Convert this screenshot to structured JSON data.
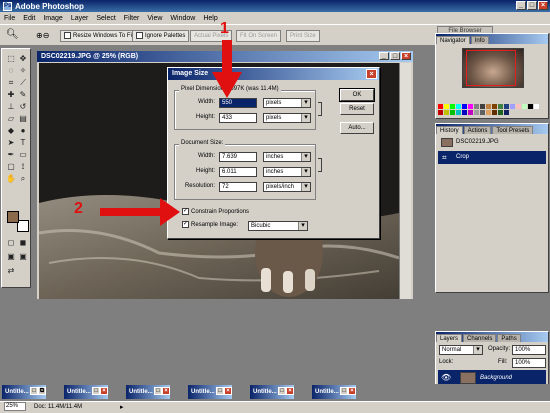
{
  "app": {
    "title": "Adobe Photoshop"
  },
  "menu": [
    "File",
    "Edit",
    "Image",
    "Layer",
    "Select",
    "Filter",
    "View",
    "Window",
    "Help"
  ],
  "options": {
    "resize_windows": "Resize Windows To Fit",
    "ignore_palettes": "Ignore Palettes",
    "actual_pixels": "Actual Pixels",
    "fit_on_screen": "Fit On Screen",
    "print_size": "Print Size",
    "file_browser": "File Browser"
  },
  "document": {
    "title": "DSC02219.JPG @ 25% (RGB)"
  },
  "dialog": {
    "title": "Image Size",
    "pixel_dimensions": "Pixel Dimensions: 697K (was 11.4M)",
    "width_label": "Width:",
    "width_value": "550",
    "width_unit": "pixels",
    "height_label": "Height:",
    "height_value": "433",
    "height_unit": "pixels",
    "document_size": "Document Size:",
    "doc_width_label": "Width:",
    "doc_width_value": "7.639",
    "doc_width_unit": "inches",
    "doc_height_label": "Height:",
    "doc_height_value": "6.011",
    "doc_height_unit": "inches",
    "resolution_label": "Resolution:",
    "resolution_value": "72",
    "resolution_unit": "pixels/inch",
    "constrain": "Constrain Proportions",
    "resample": "Resample Image:",
    "resample_method": "Bicubic",
    "ok": "OK",
    "reset": "Reset",
    "auto": "Auto..."
  },
  "annotations": {
    "one": "1",
    "two": "2"
  },
  "navigator": {
    "tab1": "Navigator",
    "tab2": "Info"
  },
  "history": {
    "tabs": [
      "History",
      "Actions",
      "Tool Presets"
    ],
    "items": [
      "DSC02219.JPG",
      "Crop"
    ]
  },
  "layers": {
    "tabs": [
      "Layers",
      "Channels",
      "Paths"
    ],
    "blend_mode": "Normal",
    "opacity_label": "Opacity:",
    "opacity": "100%",
    "lock_label": "Lock:",
    "fill_label": "Fill:",
    "fill": "100%",
    "layer_name": "Background"
  },
  "taskbar": {
    "item": "Untitle..."
  },
  "status": {
    "zoom": "25%",
    "doc": "Doc: 11.4M/11.4M"
  },
  "colors": {
    "foreground": "#8a6a4a",
    "background": "#ffffff",
    "accent": "#0a246a",
    "annotation": "#e01010"
  }
}
